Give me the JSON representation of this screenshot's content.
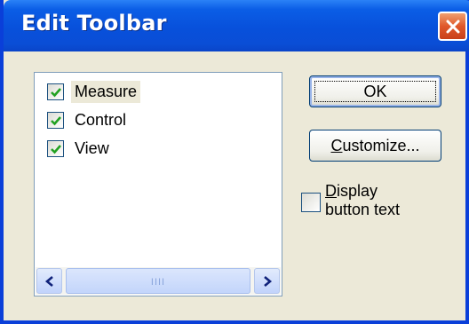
{
  "window": {
    "title": "Edit Toolbar",
    "title_bar_color": "#0a4ed6",
    "close_button_color": "#e0582a"
  },
  "list": {
    "items": [
      {
        "label": "Measure",
        "checked": true,
        "selected": true
      },
      {
        "label": "Control",
        "checked": true,
        "selected": false
      },
      {
        "label": "View",
        "checked": true,
        "selected": false
      }
    ],
    "check_color": "#21a121"
  },
  "buttons": {
    "ok_label": "OK",
    "customize_label_mnemonic": "C",
    "customize_label_rest": "ustomize..."
  },
  "display_text": {
    "line1_mnemonic": "D",
    "line1_rest": "isplay",
    "line2": "button text",
    "checked": false
  },
  "icons": {
    "close": "close-icon",
    "check": "check-icon",
    "scroll_left": "arrow-left-icon",
    "scroll_right": "arrow-right-icon",
    "grip": "grip-icon"
  }
}
